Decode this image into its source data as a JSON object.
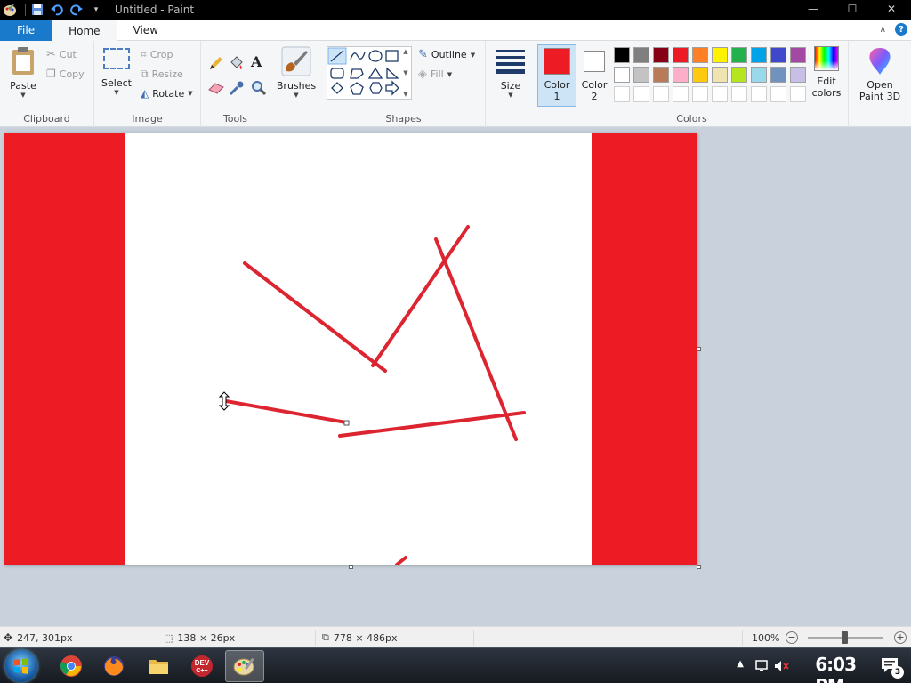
{
  "titlebar": {
    "title": "Untitled - Paint",
    "minimize": "—",
    "maximize": "☐",
    "close": "✕"
  },
  "tabs": {
    "file": "File",
    "home": "Home",
    "view": "View"
  },
  "ribbon": {
    "clipboard": {
      "label": "Clipboard",
      "paste": "Paste",
      "cut": "Cut",
      "copy": "Copy"
    },
    "image": {
      "label": "Image",
      "select": "Select",
      "crop": "Crop",
      "resize": "Resize",
      "rotate": "Rotate"
    },
    "tools": {
      "label": "Tools"
    },
    "brushes": {
      "label": "Brushes"
    },
    "shapes": {
      "label": "Shapes",
      "outline": "Outline",
      "fill": "Fill"
    },
    "size": {
      "label": "Size"
    },
    "colors": {
      "label": "Colors",
      "color1": "Color 1",
      "color2": "Color 2",
      "color1_value": "#ed1c24",
      "color2_value": "#ffffff",
      "edit_colors": "Edit colors",
      "palette_row1": [
        "#000000",
        "#7f7f7f",
        "#880015",
        "#ed1c24",
        "#ff7f27",
        "#fff200",
        "#22b14c",
        "#00a2e8",
        "#3f48cc",
        "#a349a4"
      ],
      "palette_row2": [
        "#ffffff",
        "#c3c3c3",
        "#b97a57",
        "#ffaec9",
        "#ffc90e",
        "#efe4b0",
        "#b5e61d",
        "#99d9ea",
        "#7092be",
        "#c8bfe7"
      ]
    },
    "paint3d": {
      "label": "Open Paint 3D"
    }
  },
  "canvas": {
    "fill_color": "#ed1c24",
    "line_color": "#dc2530"
  },
  "status": {
    "cursor_pos": "247, 301px",
    "selection_size": "138 × 26px",
    "image_size": "778 × 486px",
    "zoom": "100%"
  },
  "taskbar": {
    "clock": "6:03 PM",
    "notifications": "3",
    "apps": [
      "chrome",
      "firefox",
      "file-explorer",
      "dev-cpp",
      "paint"
    ]
  }
}
